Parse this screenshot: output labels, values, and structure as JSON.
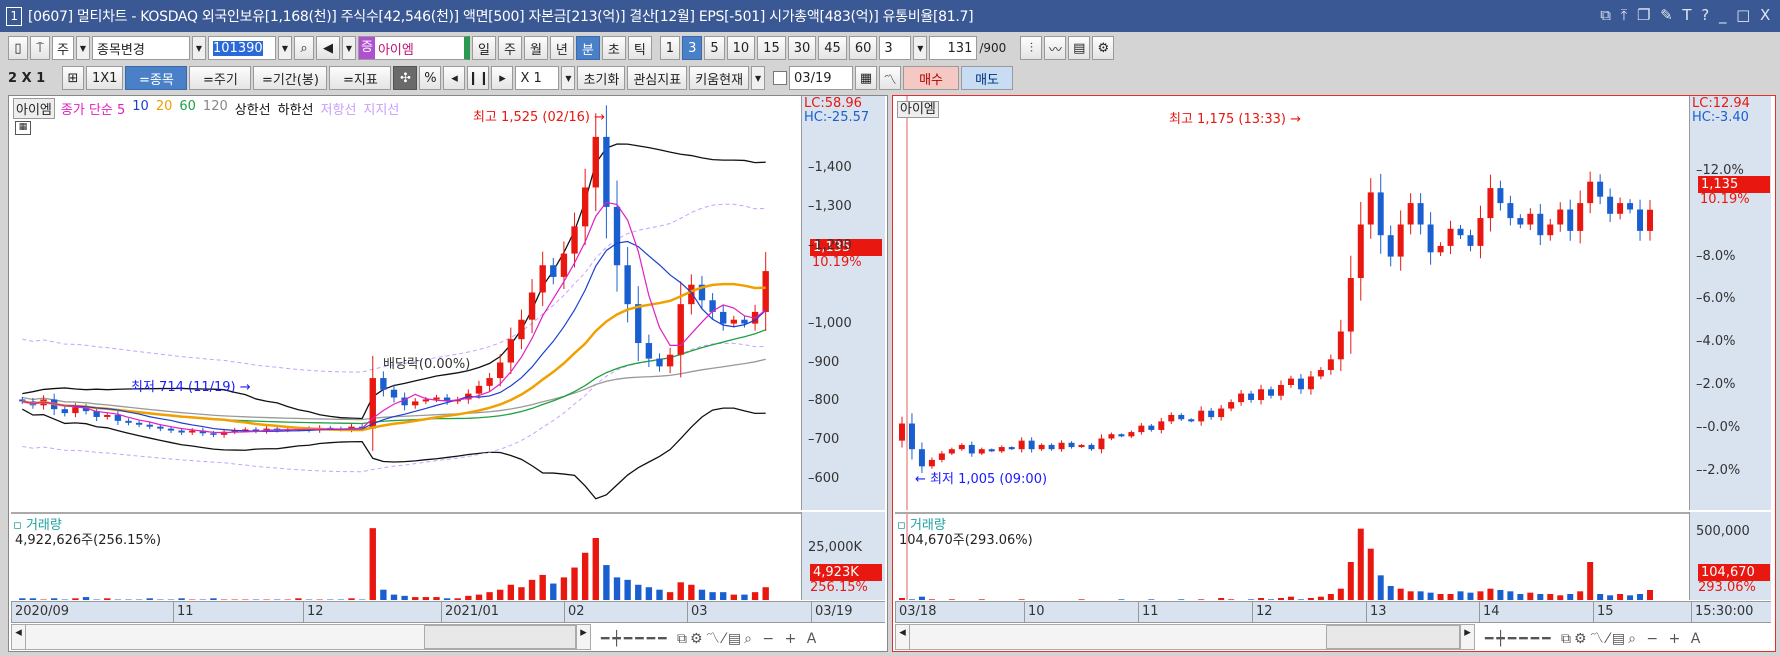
{
  "window": {
    "num": "1",
    "title": "[0607] 멀티차트 - KOSDAQ 외국인보유[1,168(천)] 주식수[42,546(천)] 액면[500] 자본금[213(억)] 결산[12월] EPS[-501] 시가총액[483(억)] 유통비율[81.7]",
    "controls": [
      "⧉",
      "⤒",
      "❐",
      "✎",
      "T",
      "?",
      "_",
      "□",
      "X"
    ]
  },
  "toolbar1": {
    "market": "주",
    "change_label": "종목변경",
    "code": "101390",
    "stock_name": "아이엠",
    "stock_badge": "증",
    "periods": [
      "일",
      "주",
      "월",
      "년"
    ],
    "units": [
      "분",
      "초",
      "틱"
    ],
    "active_unit": "분",
    "minutes": [
      "1",
      "3",
      "5",
      "10",
      "15",
      "30",
      "45",
      "60"
    ],
    "active_minute": "3",
    "count_select": "3",
    "count": "131",
    "count_max": "/900"
  },
  "toolbar2": {
    "layout": "2 X 1",
    "one": "1X1",
    "btn_stock": "=종목",
    "btn_period": "=주기",
    "btn_range": "=기간(봉)",
    "btn_indicator": "=지표",
    "percent": "%",
    "zoom": "X 1",
    "reset": "초기화",
    "interest": "관심지표",
    "kiwoom": "키움현재",
    "date": "03/19",
    "buy": "매수",
    "sell": "매도"
  },
  "colors": {
    "up": "#e8170f",
    "down": "#1a5fd0",
    "ma5": "#e020c0",
    "ma10": "#1a3fd0",
    "ma20": "#f0a000",
    "ma60": "#20a040",
    "ma120": "#999999",
    "band": "#111111",
    "env": "#c8a0ff"
  },
  "left": {
    "stock": "아이엠",
    "legend": [
      {
        "t": "종가 단순 5",
        "c": "#e020c0"
      },
      {
        "t": "10",
        "c": "#1a3fd0"
      },
      {
        "t": "20",
        "c": "#f0a000"
      },
      {
        "t": "60",
        "c": "#20a040"
      },
      {
        "t": "120",
        "c": "#888888"
      },
      {
        "t": "상한선",
        "c": "#111111"
      },
      {
        "t": "하한선",
        "c": "#111111"
      },
      {
        "t": "저항선",
        "c": "#c8a0ff"
      },
      {
        "t": "지지선",
        "c": "#c8a0ff"
      }
    ],
    "lc": "LC:58.96",
    "hc": "HC:-25.57",
    "ticks": [
      "1,400",
      "1,300",
      "1,200",
      "1,000",
      "900",
      "800",
      "700",
      "600"
    ],
    "tick_values": [
      1400,
      1300,
      1200,
      1000,
      900,
      800,
      700,
      600
    ],
    "price_tag": "1,135",
    "change": "10.19%",
    "high_note": "최고 1,525 (02/16)",
    "low_note": "최저 714 (11/19)",
    "dividend_note": "배당락(0.00%)",
    "volume_title": "거래량",
    "volume_text": "4,922,626주(256.15%)",
    "vol_tick": "25,000K",
    "vol_tag": "4,923K",
    "vol_pct": "256.15%",
    "dates": [
      "2020/09",
      "11",
      "12",
      "2021/01",
      "02",
      "03",
      "03/19"
    ],
    "closes": [
      800,
      790,
      805,
      780,
      770,
      785,
      775,
      760,
      765,
      750,
      745,
      740,
      735,
      730,
      725,
      720,
      725,
      718,
      714,
      722,
      726,
      728,
      724,
      730,
      726,
      728,
      730,
      726,
      732,
      730,
      728,
      735,
      730,
      860,
      830,
      810,
      790,
      800,
      805,
      810,
      800,
      805,
      820,
      840,
      860,
      900,
      960,
      1010,
      1080,
      1150,
      1120,
      1180,
      1250,
      1350,
      1480,
      1300,
      1150,
      1050,
      950,
      910,
      890,
      920,
      1050,
      1100,
      1060,
      1030,
      1000,
      1010,
      1000,
      1030,
      1135
    ],
    "volumes": [
      3,
      3,
      2,
      3,
      2,
      3,
      4,
      2,
      3,
      2,
      2,
      2,
      3,
      2,
      2,
      3,
      2,
      2,
      3,
      2,
      2,
      2,
      2,
      2,
      2,
      2,
      3,
      2,
      2,
      2,
      2,
      3,
      2,
      60,
      10,
      6,
      5,
      4,
      4,
      4,
      3,
      3,
      5,
      6,
      8,
      10,
      14,
      12,
      18,
      22,
      15,
      20,
      28,
      40,
      52,
      30,
      20,
      18,
      14,
      12,
      10,
      8,
      16,
      14,
      10,
      8,
      8,
      6,
      6,
      8,
      12
    ],
    "vol_max": 65
  },
  "right": {
    "stock": "아이엠",
    "lc": "LC:12.94",
    "hc": "HC:-3.40",
    "ticks": [
      "12.0%",
      "8.0%",
      "6.0%",
      "4.0%",
      "2.0%",
      "-0.0%",
      "-2.0%"
    ],
    "tick_values": [
      12,
      8,
      6,
      4,
      2,
      0,
      -2
    ],
    "price_tag": "1,135",
    "change": "10.19%",
    "high_note": "최고 1,175 (13:33)",
    "low_note": "최저 1,005 (09:00)",
    "volume_title": "거래량",
    "volume_text": "104,670주(293.06%)",
    "vol_tick": "500,000",
    "vol_tag": "104,670",
    "vol_pct": "293.06%",
    "dates": [
      "03/18",
      "10",
      "11",
      "12",
      "13",
      "14",
      "15",
      "15:30:00"
    ],
    "pcts": [
      0.2,
      -1.0,
      -1.8,
      -1.5,
      -1.2,
      -1.0,
      -0.8,
      -1.2,
      -1.0,
      -1.1,
      -0.9,
      -1.0,
      -0.6,
      -1.0,
      -0.8,
      -1.0,
      -0.7,
      -0.9,
      -0.8,
      -1.0,
      -0.5,
      -0.3,
      -0.4,
      -0.2,
      0.1,
      -0.1,
      0.3,
      0.6,
      0.4,
      0.3,
      0.8,
      0.5,
      0.9,
      1.2,
      1.6,
      1.3,
      1.8,
      1.5,
      2.0,
      2.3,
      1.8,
      2.4,
      2.7,
      3.2,
      4.5,
      7.0,
      9.5,
      11.0,
      9.0,
      8.0,
      9.5,
      10.5,
      9.5,
      8.2,
      8.5,
      9.3,
      9.0,
      8.5,
      9.8,
      11.2,
      10.5,
      9.8,
      9.5,
      10.0,
      9.0,
      9.5,
      10.2,
      9.2,
      10.5,
      11.5,
      10.8,
      10.0,
      10.5,
      10.2,
      9.2,
      10.19
    ],
    "volumes": [
      3,
      2,
      4,
      2,
      1,
      2,
      1,
      1,
      2,
      1,
      1,
      1,
      2,
      1,
      1,
      1,
      1,
      1,
      2,
      1,
      1,
      1,
      2,
      1,
      1,
      2,
      1,
      1,
      2,
      1,
      2,
      1,
      3,
      2,
      1,
      2,
      3,
      2,
      3,
      4,
      2,
      3,
      4,
      6,
      10,
      30,
      55,
      40,
      20,
      12,
      10,
      8,
      8,
      7,
      6,
      6,
      8,
      7,
      8,
      10,
      9,
      8,
      6,
      7,
      6,
      6,
      5,
      6,
      8,
      30,
      6,
      5,
      6,
      5,
      6,
      9
    ],
    "vol_max": 60
  }
}
